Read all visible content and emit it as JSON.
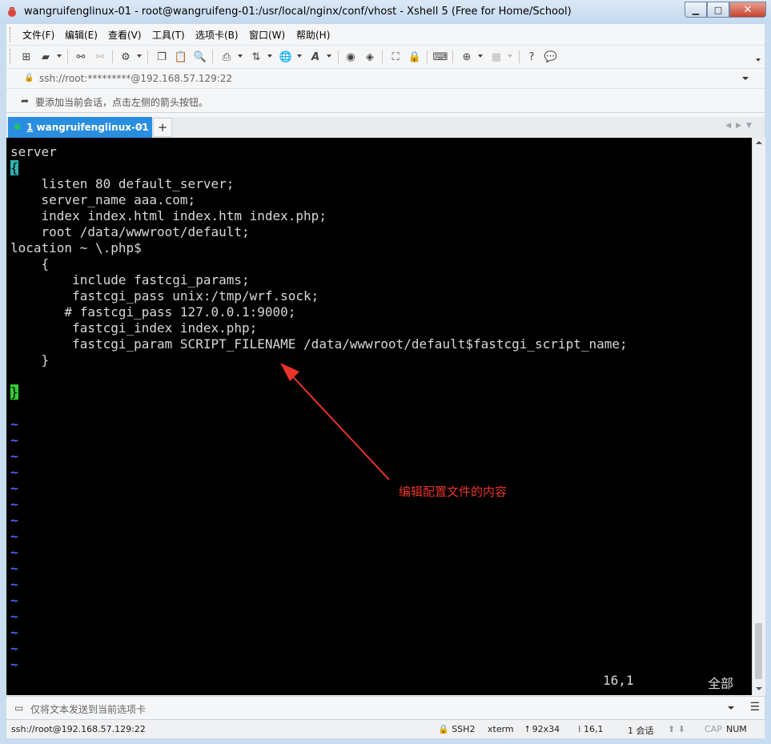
{
  "window": {
    "title": "wangruifenglinux-01 - root@wangruifeng-01:/usr/local/nginx/conf/vhost - Xshell 5 (Free for Home/School)"
  },
  "menu": [
    "文件(F)",
    "编辑(E)",
    "查看(V)",
    "工具(T)",
    "选项卡(B)",
    "窗口(W)",
    "帮助(H)"
  ],
  "address": {
    "value": "ssh://root:*********@192.168.57.129:22"
  },
  "hint": {
    "text": "要添加当前会话，点击左侧的箭头按钮。"
  },
  "tab": {
    "index": "1",
    "label": "wangruifenglinux-01",
    "close": "×",
    "add": "+"
  },
  "terminal": {
    "lines": [
      "server",
      "{",
      "    listen 80 default_server;",
      "    server_name aaa.com;",
      "    index index.html index.htm index.php;",
      "    root /data/wwwroot/default;",
      "location ~ \\.php$",
      "    {",
      "        include fastcgi_params;",
      "        fastcgi_pass unix:/tmp/wrf.sock;",
      "       # fastcgi_pass 127.0.0.1:9000;",
      "        fastcgi_index index.php;",
      "        fastcgi_param SCRIPT_FILENAME /data/wwwroot/default$fastcgi_script_name;",
      "    }",
      "",
      "}",
      "",
      "~",
      "~",
      "~",
      "~",
      "~",
      "~",
      "~",
      "~",
      "~",
      "~",
      "~",
      "~",
      "~",
      "~",
      "~",
      "~"
    ],
    "cursor_pos": "16,1",
    "scroll_pos": "全部"
  },
  "annotation": {
    "text": "编辑配置文件的内容",
    "color": "#e8342a"
  },
  "send_bar": {
    "placeholder": "仅将文本发送到当前选项卡"
  },
  "status": {
    "connection": "ssh://root@192.168.57.129:22",
    "protocol": "SSH2",
    "term": "xterm",
    "size": "92x34",
    "position": "16,1",
    "sessions": "1 会话",
    "cap": "CAP",
    "num": "NUM"
  },
  "colors": {
    "tab_active": "#2a8ee0",
    "brace_cyan": "#2fb2b2",
    "brace_green": "#33cc33",
    "tilde_blue": "#4a6cff"
  }
}
